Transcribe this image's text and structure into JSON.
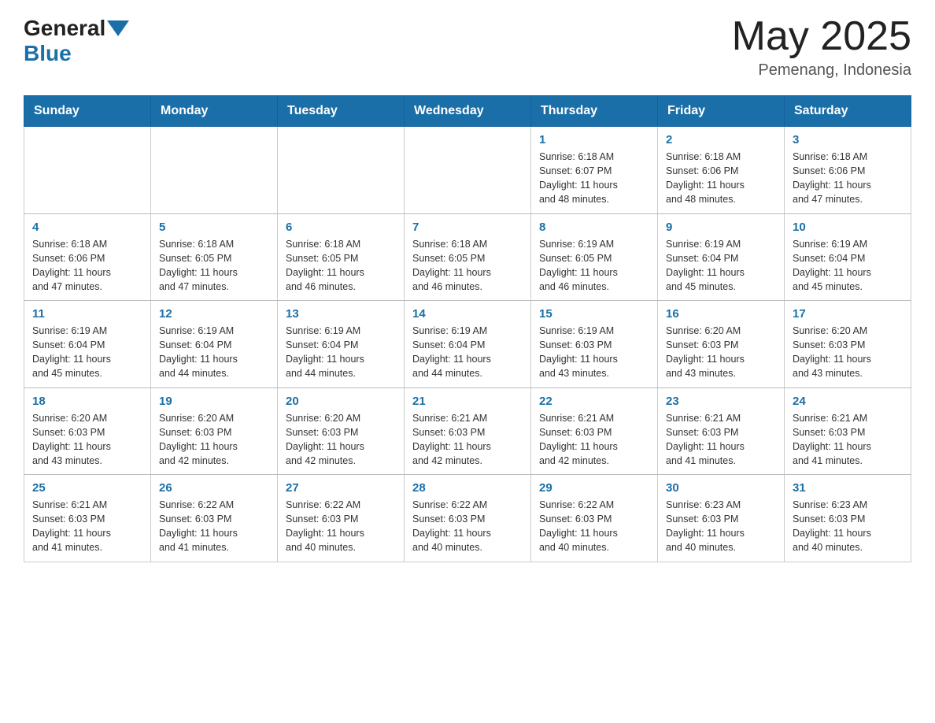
{
  "header": {
    "logo_general": "General",
    "logo_blue": "Blue",
    "month_year": "May 2025",
    "location": "Pemenang, Indonesia"
  },
  "weekdays": [
    "Sunday",
    "Monday",
    "Tuesday",
    "Wednesday",
    "Thursday",
    "Friday",
    "Saturday"
  ],
  "weeks": [
    [
      {
        "day": "",
        "info": ""
      },
      {
        "day": "",
        "info": ""
      },
      {
        "day": "",
        "info": ""
      },
      {
        "day": "",
        "info": ""
      },
      {
        "day": "1",
        "info": "Sunrise: 6:18 AM\nSunset: 6:07 PM\nDaylight: 11 hours\nand 48 minutes."
      },
      {
        "day": "2",
        "info": "Sunrise: 6:18 AM\nSunset: 6:06 PM\nDaylight: 11 hours\nand 48 minutes."
      },
      {
        "day": "3",
        "info": "Sunrise: 6:18 AM\nSunset: 6:06 PM\nDaylight: 11 hours\nand 47 minutes."
      }
    ],
    [
      {
        "day": "4",
        "info": "Sunrise: 6:18 AM\nSunset: 6:06 PM\nDaylight: 11 hours\nand 47 minutes."
      },
      {
        "day": "5",
        "info": "Sunrise: 6:18 AM\nSunset: 6:05 PM\nDaylight: 11 hours\nand 47 minutes."
      },
      {
        "day": "6",
        "info": "Sunrise: 6:18 AM\nSunset: 6:05 PM\nDaylight: 11 hours\nand 46 minutes."
      },
      {
        "day": "7",
        "info": "Sunrise: 6:18 AM\nSunset: 6:05 PM\nDaylight: 11 hours\nand 46 minutes."
      },
      {
        "day": "8",
        "info": "Sunrise: 6:19 AM\nSunset: 6:05 PM\nDaylight: 11 hours\nand 46 minutes."
      },
      {
        "day": "9",
        "info": "Sunrise: 6:19 AM\nSunset: 6:04 PM\nDaylight: 11 hours\nand 45 minutes."
      },
      {
        "day": "10",
        "info": "Sunrise: 6:19 AM\nSunset: 6:04 PM\nDaylight: 11 hours\nand 45 minutes."
      }
    ],
    [
      {
        "day": "11",
        "info": "Sunrise: 6:19 AM\nSunset: 6:04 PM\nDaylight: 11 hours\nand 45 minutes."
      },
      {
        "day": "12",
        "info": "Sunrise: 6:19 AM\nSunset: 6:04 PM\nDaylight: 11 hours\nand 44 minutes."
      },
      {
        "day": "13",
        "info": "Sunrise: 6:19 AM\nSunset: 6:04 PM\nDaylight: 11 hours\nand 44 minutes."
      },
      {
        "day": "14",
        "info": "Sunrise: 6:19 AM\nSunset: 6:04 PM\nDaylight: 11 hours\nand 44 minutes."
      },
      {
        "day": "15",
        "info": "Sunrise: 6:19 AM\nSunset: 6:03 PM\nDaylight: 11 hours\nand 43 minutes."
      },
      {
        "day": "16",
        "info": "Sunrise: 6:20 AM\nSunset: 6:03 PM\nDaylight: 11 hours\nand 43 minutes."
      },
      {
        "day": "17",
        "info": "Sunrise: 6:20 AM\nSunset: 6:03 PM\nDaylight: 11 hours\nand 43 minutes."
      }
    ],
    [
      {
        "day": "18",
        "info": "Sunrise: 6:20 AM\nSunset: 6:03 PM\nDaylight: 11 hours\nand 43 minutes."
      },
      {
        "day": "19",
        "info": "Sunrise: 6:20 AM\nSunset: 6:03 PM\nDaylight: 11 hours\nand 42 minutes."
      },
      {
        "day": "20",
        "info": "Sunrise: 6:20 AM\nSunset: 6:03 PM\nDaylight: 11 hours\nand 42 minutes."
      },
      {
        "day": "21",
        "info": "Sunrise: 6:21 AM\nSunset: 6:03 PM\nDaylight: 11 hours\nand 42 minutes."
      },
      {
        "day": "22",
        "info": "Sunrise: 6:21 AM\nSunset: 6:03 PM\nDaylight: 11 hours\nand 42 minutes."
      },
      {
        "day": "23",
        "info": "Sunrise: 6:21 AM\nSunset: 6:03 PM\nDaylight: 11 hours\nand 41 minutes."
      },
      {
        "day": "24",
        "info": "Sunrise: 6:21 AM\nSunset: 6:03 PM\nDaylight: 11 hours\nand 41 minutes."
      }
    ],
    [
      {
        "day": "25",
        "info": "Sunrise: 6:21 AM\nSunset: 6:03 PM\nDaylight: 11 hours\nand 41 minutes."
      },
      {
        "day": "26",
        "info": "Sunrise: 6:22 AM\nSunset: 6:03 PM\nDaylight: 11 hours\nand 41 minutes."
      },
      {
        "day": "27",
        "info": "Sunrise: 6:22 AM\nSunset: 6:03 PM\nDaylight: 11 hours\nand 40 minutes."
      },
      {
        "day": "28",
        "info": "Sunrise: 6:22 AM\nSunset: 6:03 PM\nDaylight: 11 hours\nand 40 minutes."
      },
      {
        "day": "29",
        "info": "Sunrise: 6:22 AM\nSunset: 6:03 PM\nDaylight: 11 hours\nand 40 minutes."
      },
      {
        "day": "30",
        "info": "Sunrise: 6:23 AM\nSunset: 6:03 PM\nDaylight: 11 hours\nand 40 minutes."
      },
      {
        "day": "31",
        "info": "Sunrise: 6:23 AM\nSunset: 6:03 PM\nDaylight: 11 hours\nand 40 minutes."
      }
    ]
  ]
}
